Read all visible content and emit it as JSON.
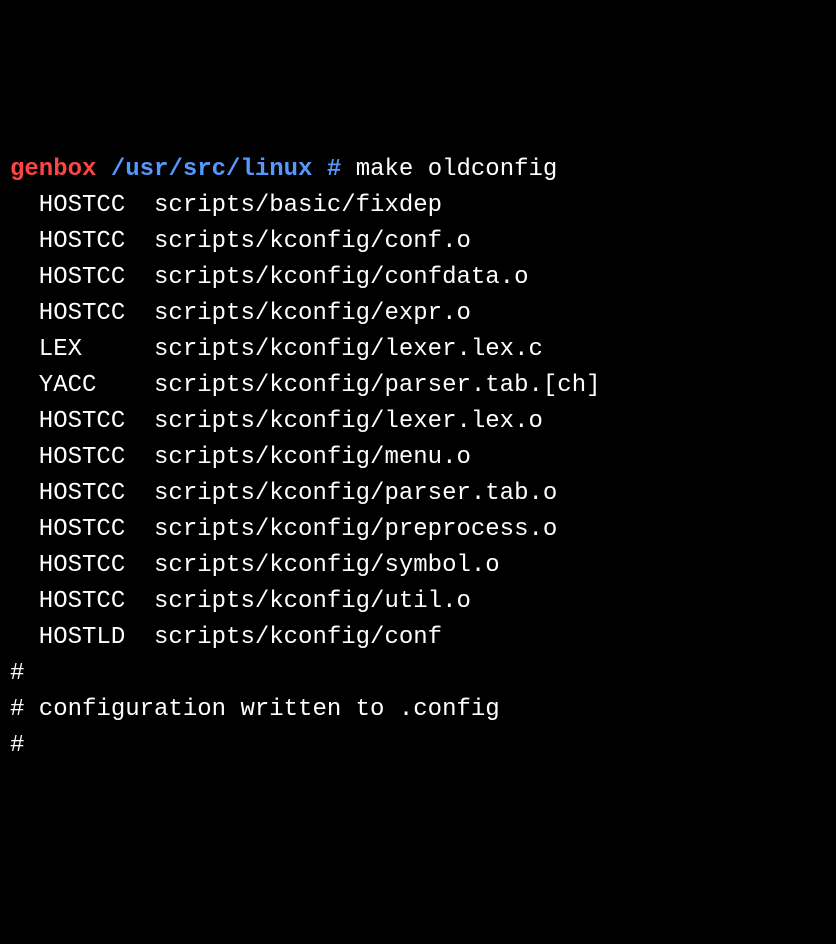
{
  "prompt": {
    "hostname": "genbox",
    "path": "/usr/src/linux",
    "hash": "#",
    "command": "make oldconfig"
  },
  "build_lines": [
    {
      "tool": "HOSTCC",
      "file": "scripts/basic/fixdep"
    },
    {
      "tool": "HOSTCC",
      "file": "scripts/kconfig/conf.o"
    },
    {
      "tool": "HOSTCC",
      "file": "scripts/kconfig/confdata.o"
    },
    {
      "tool": "HOSTCC",
      "file": "scripts/kconfig/expr.o"
    },
    {
      "tool": "LEX",
      "file": "scripts/kconfig/lexer.lex.c"
    },
    {
      "tool": "YACC",
      "file": "scripts/kconfig/parser.tab.[ch]"
    },
    {
      "tool": "HOSTCC",
      "file": "scripts/kconfig/lexer.lex.o"
    },
    {
      "tool": "HOSTCC",
      "file": "scripts/kconfig/menu.o"
    },
    {
      "tool": "HOSTCC",
      "file": "scripts/kconfig/parser.tab.o"
    },
    {
      "tool": "HOSTCC",
      "file": "scripts/kconfig/preprocess.o"
    },
    {
      "tool": "HOSTCC",
      "file": "scripts/kconfig/symbol.o"
    },
    {
      "tool": "HOSTCC",
      "file": "scripts/kconfig/util.o"
    },
    {
      "tool": "HOSTLD",
      "file": "scripts/kconfig/conf"
    }
  ],
  "footer": {
    "line1": "#",
    "line2": "# configuration written to .config",
    "line3": "#"
  }
}
